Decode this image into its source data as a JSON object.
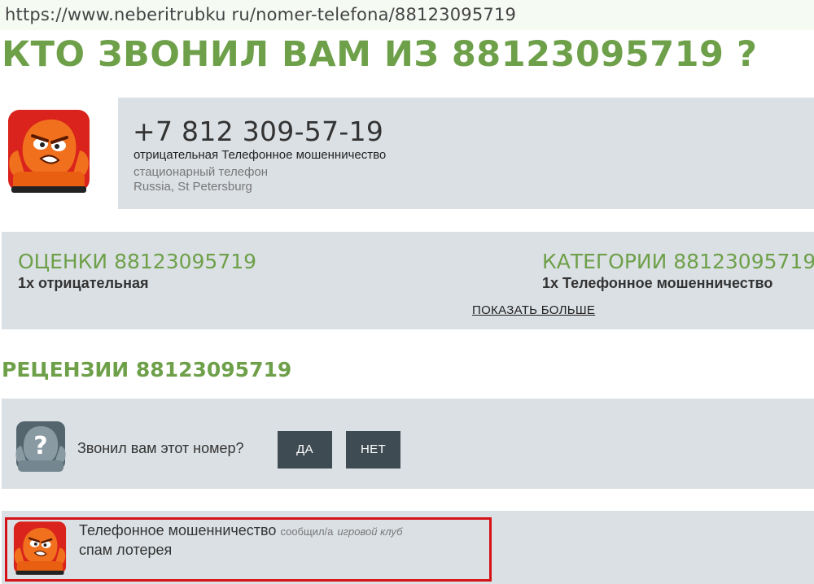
{
  "browser": {
    "url": "https://www.neberitrubku ru/nomer-telefona/88123095719"
  },
  "page": {
    "title": "КТО ЗВОНИЛ ВАМ ИЗ 88123095719 ?"
  },
  "number_info": {
    "phone": "+7 812 309-57-19",
    "rating_category": "отрицательная Телефонное мошенничество",
    "line_type": "стационарный телефон",
    "location": "Russia, St Petersburg",
    "avatar_icon": "angry-orange-monster-icon"
  },
  "stats": {
    "ratings_title": "ОЦЕНКИ 88123095719",
    "ratings_value": "1x отрицательная",
    "categories_title": "КАТЕГОРИИ 88123095719",
    "categories_value": "1x Телефонное мошенничество",
    "show_more": "ПОКАЗАТЬ БОЛЬШЕ"
  },
  "reviews": {
    "title": "РЕЦЕНЗИИ 88123095719",
    "ask": {
      "question": "Звонил вам этот номер?",
      "yes_label": "ДА",
      "no_label": "НЕТ",
      "icon": "question-mark-monster-icon"
    },
    "items": [
      {
        "category": "Телефонное мошенничество",
        "reported_by_label": "сообщил/а",
        "author": "игровой клуб",
        "text": "спам лотерея",
        "icon": "angry-orange-monster-icon"
      }
    ]
  },
  "colors": {
    "accent_green": "#6ea04a",
    "panel_gray": "#dbe0e4",
    "button_dark": "#3f4b53",
    "highlight_red": "#d51218",
    "monster_orange": "#f0701e",
    "monster_red_bg": "#d9231c"
  }
}
